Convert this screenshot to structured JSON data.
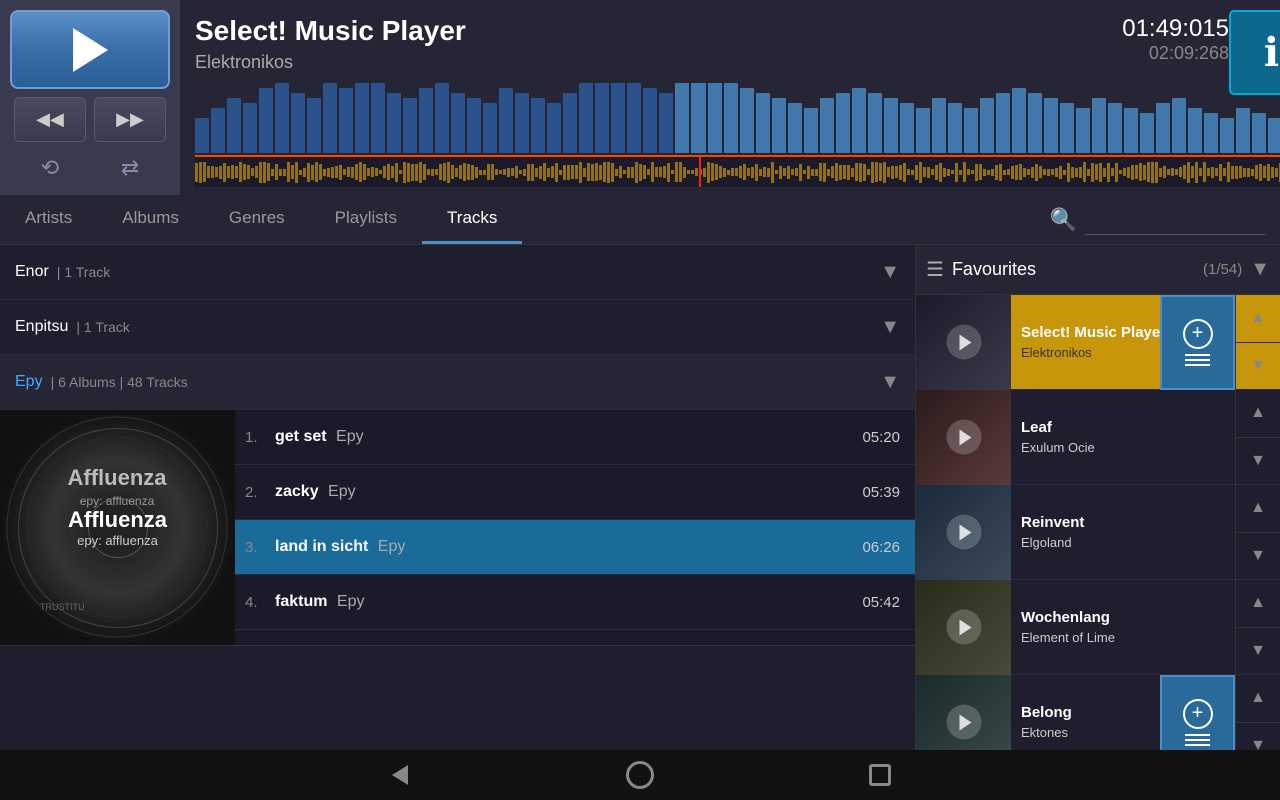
{
  "app": {
    "title": "Select! Music Player"
  },
  "player": {
    "track_title": "Select! Music Player",
    "artist": "Elektronikos",
    "time_current": "01:49:015",
    "time_total": "02:09:268",
    "album_cover_title": "Affluenza",
    "album_cover_subtitle": "epy: affluenza",
    "play_label": "▶",
    "prev_label": "◀◀",
    "next_label": "▶▶",
    "repeat_label": "⟲",
    "shuffle_label": "⇄"
  },
  "nav": {
    "tabs": [
      {
        "id": "artists",
        "label": "Artists"
      },
      {
        "id": "albums",
        "label": "Albums"
      },
      {
        "id": "genres",
        "label": "Genres"
      },
      {
        "id": "playlists",
        "label": "Playlists"
      },
      {
        "id": "tracks",
        "label": "Tracks"
      }
    ],
    "active_tab": "tracks",
    "search_placeholder": ""
  },
  "library": {
    "artists": [
      {
        "name": "Enor",
        "meta": "| 1 Track",
        "expanded": false
      },
      {
        "name": "Enpitsu",
        "meta": "| 1 Track",
        "expanded": false
      },
      {
        "name": "Epy",
        "meta": "| 6 Albums | 48 Tracks",
        "expanded": true,
        "tracks": [
          {
            "num": "1.",
            "name": "get set",
            "artist": "Epy",
            "duration": "05:20",
            "playing": false
          },
          {
            "num": "2.",
            "name": "zacky",
            "artist": "Epy",
            "duration": "05:39",
            "playing": false
          },
          {
            "num": "3.",
            "name": "land in sicht",
            "artist": "Epy",
            "duration": "06:26",
            "playing": true
          },
          {
            "num": "4.",
            "name": "faktum",
            "artist": "Epy",
            "duration": "05:42",
            "playing": false
          }
        ]
      }
    ]
  },
  "favourites": {
    "title": "Favourites",
    "count": "(1/54)",
    "items": [
      {
        "id": "fav1",
        "track": "Select! Music Player",
        "artist": "Elektronikos",
        "thumb_class": "t1",
        "active": true
      },
      {
        "id": "fav2",
        "track": "Leaf",
        "artist": "Exulum Ocie",
        "thumb_class": "t2",
        "active": false
      },
      {
        "id": "fav3",
        "track": "Reinvent",
        "artist": "Elgoland",
        "thumb_class": "t3",
        "active": false
      },
      {
        "id": "fav4",
        "track": "Wochenlang",
        "artist": "Element of Lime",
        "thumb_class": "t4",
        "active": false
      },
      {
        "id": "fav5",
        "track": "Belong",
        "artist": "Ektones",
        "thumb_class": "t5",
        "active": false
      }
    ]
  },
  "bottom_nav": {
    "back": "back",
    "home": "home",
    "recents": "recents"
  },
  "icons": {
    "search": "🔍",
    "menu_dots": "⋮",
    "eye": "👁",
    "up_arrow": "▲",
    "down_arrow": "▼",
    "list": "≡",
    "chevron_down": "▼",
    "plus": "+"
  }
}
